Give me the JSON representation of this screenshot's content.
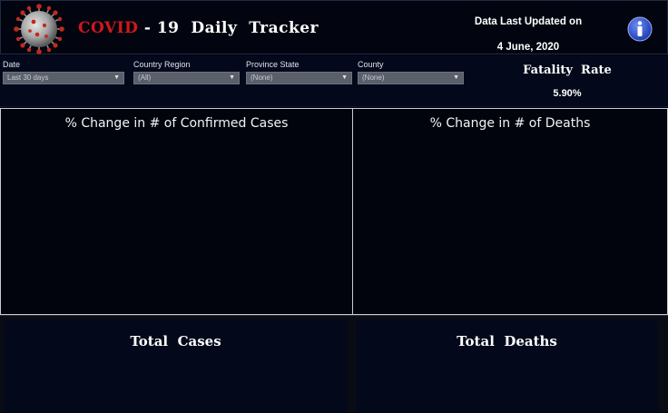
{
  "header": {
    "title_highlight": "COVID",
    "title_rest": " - 19  Daily  Tracker",
    "updated_label": "Data Last Updated on",
    "updated_date": "4 June, 2020",
    "icons": {
      "logo": "virus-icon",
      "info": "info-icon"
    },
    "colors": {
      "highlight": "#d2171c",
      "info": "#2a4fcf"
    }
  },
  "filters": [
    {
      "label": "Date",
      "value": "Last 30 days"
    },
    {
      "label": "Country Region",
      "value": "(All)"
    },
    {
      "label": "Province State",
      "value": "(None)"
    },
    {
      "label": "County",
      "value": "(None)"
    }
  ],
  "fatality": {
    "title": "Fatality  Rate",
    "value": "5.90%"
  },
  "panels": {
    "confirmed_title": "% Change in # of Confirmed Cases",
    "deaths_title": "% Change in # of Deaths"
  },
  "totals": {
    "cases_title": "Total  Cases",
    "deaths_title": "Total  Deaths"
  }
}
